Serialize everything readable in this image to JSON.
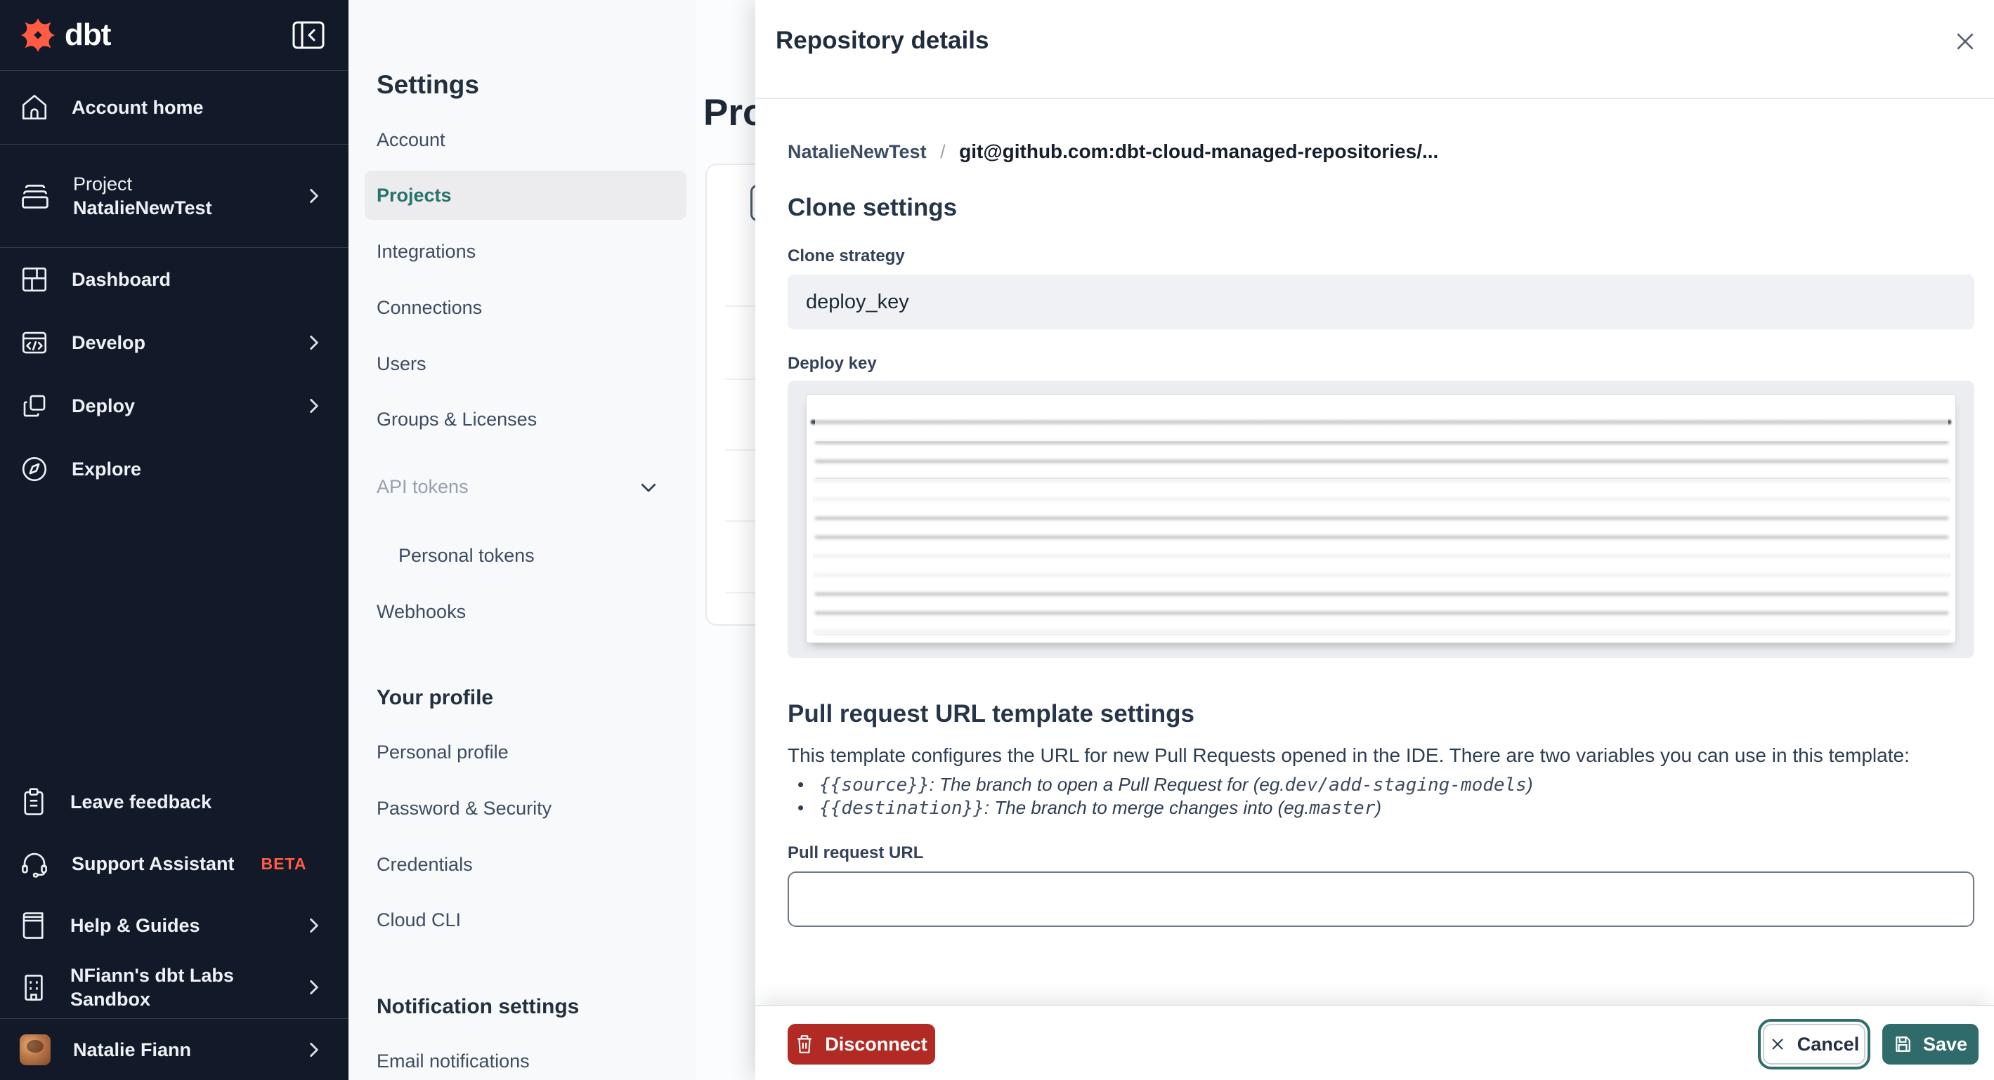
{
  "colors": {
    "sidebar_bg": "#121a29",
    "brand_orange": "#ff5c43",
    "accent_teal": "#2e6b6a",
    "active_link_teal": "#26726d",
    "danger_red": "#b12b24",
    "panel_bg": "#f8f9fa",
    "text_dark": "#1f2d3d"
  },
  "sidebar": {
    "logo_text": "dbt",
    "account_home": "Account home",
    "project": {
      "line1": "Project",
      "line2": "NatalieNewTest"
    },
    "items": [
      {
        "label": "Dashboard"
      },
      {
        "label": "Develop"
      },
      {
        "label": "Deploy"
      },
      {
        "label": "Explore"
      }
    ],
    "bottom_items": [
      {
        "label": "Leave feedback"
      },
      {
        "label": "Support Assistant",
        "badge": "BETA"
      },
      {
        "label": "Help & Guides"
      },
      {
        "label": "NFiann's dbt Labs Sandbox"
      }
    ],
    "user": {
      "name": "Natalie Fiann"
    }
  },
  "settings_nav": {
    "title": "Settings",
    "item_account": "Account",
    "item_projects": "Projects",
    "item_integrations": "Integrations",
    "item_connections": "Connections",
    "item_users": "Users",
    "item_groups": "Groups & Licenses",
    "item_api_tokens": "API tokens",
    "item_personal_tokens": "Personal tokens",
    "item_webhooks": "Webhooks",
    "profile_heading": "Your profile",
    "item_personal_profile": "Personal profile",
    "item_password": "Password & Security",
    "item_credentials": "Credentials",
    "item_cloud_cli": "Cloud CLI",
    "notification_heading": "Notification settings",
    "item_email_notifications": "Email notifications"
  },
  "page": {
    "title": "Projects"
  },
  "modal": {
    "title": "Repository details",
    "breadcrumb": {
      "project": "NatalieNewTest",
      "separator": "/",
      "repo": "git@github.com:dbt-cloud-managed-repositories/..."
    },
    "clone": {
      "heading": "Clone settings",
      "strategy_label": "Clone strategy",
      "strategy_value": "deploy_key",
      "deploy_key_label": "Deploy key"
    },
    "pr": {
      "heading": "Pull request URL template settings",
      "description": "This template configures the URL for new Pull Requests opened in the IDE. There are two variables you can use in this template:",
      "bullets": [
        {
          "dot": "•",
          "code": "{{source}}",
          "desc": ": The branch to open a Pull Request for (eg. ",
          "example": "dev/add-staging-models",
          "suffix": ")"
        },
        {
          "dot": "•",
          "code": "{{destination}}",
          "desc": ": The branch to merge changes into (eg. ",
          "example": "master",
          "suffix": ")"
        }
      ],
      "url_label": "Pull request URL",
      "url_value": "",
      "url_placeholder": ""
    },
    "footer": {
      "disconnect": "Disconnect",
      "cancel": "Cancel",
      "save": "Save"
    }
  }
}
